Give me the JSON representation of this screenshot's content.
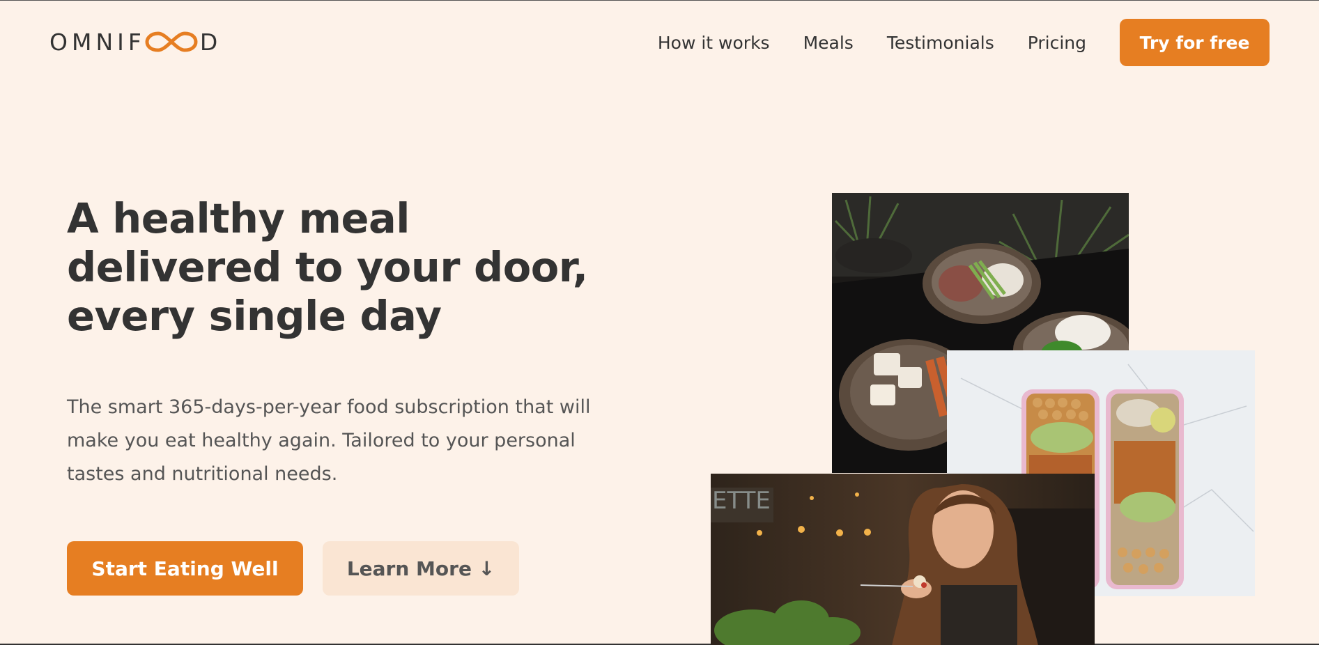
{
  "header": {
    "logo_text_left": "OMNIF",
    "logo_text_right": "D",
    "logo_icon": "infinity-icon",
    "nav": {
      "items": [
        {
          "label": "How it works"
        },
        {
          "label": "Meals"
        },
        {
          "label": "Testimonials"
        },
        {
          "label": "Pricing"
        }
      ],
      "cta_label": "Try for free"
    }
  },
  "hero": {
    "title": "A healthy meal delivered to your door, every single day",
    "description": "The smart 365-days-per-year food subscription that will make you eat healthy again. Tailored to your personal tastes and nutritional needs.",
    "primary_button": "Start Eating Well",
    "secondary_button": "Learn More ↓"
  },
  "images": {
    "bowls": "meal-bowls-image",
    "boxes": "meal-prep-boxes-image",
    "woman": "woman-eating-image"
  },
  "colors": {
    "accent": "#e67e22",
    "background": "#fdf2e9",
    "secondary_button_bg": "#fae5d3",
    "text": "#333333"
  }
}
